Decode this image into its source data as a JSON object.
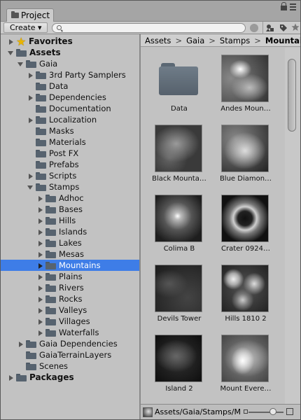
{
  "window": {
    "tab_title": "Project",
    "icons": [
      "folder-icon",
      "lock-icon",
      "menu-icon"
    ]
  },
  "toolbar": {
    "create_label": "Create ▾",
    "search_placeholder": "",
    "icons": [
      "search-icon",
      "search-clear-icon",
      "filter-by-type-icon",
      "filter-by-label-icon",
      "favorite-star-icon"
    ]
  },
  "tree": [
    {
      "label": "Favorites",
      "depth": 0,
      "arrow": "right",
      "icon": "star",
      "bold": true
    },
    {
      "label": "Assets",
      "depth": 0,
      "arrow": "down",
      "icon": "folder",
      "bold": true
    },
    {
      "label": "Gaia",
      "depth": 1,
      "arrow": "down",
      "icon": "folder"
    },
    {
      "label": "3rd Party Samplers",
      "depth": 2,
      "arrow": "right",
      "icon": "folder"
    },
    {
      "label": "Data",
      "depth": 2,
      "arrow": "",
      "icon": "folder"
    },
    {
      "label": "Dependencies",
      "depth": 2,
      "arrow": "right",
      "icon": "folder"
    },
    {
      "label": "Documentation",
      "depth": 2,
      "arrow": "",
      "icon": "folder"
    },
    {
      "label": "Localization",
      "depth": 2,
      "arrow": "right",
      "icon": "folder"
    },
    {
      "label": "Masks",
      "depth": 2,
      "arrow": "",
      "icon": "folder"
    },
    {
      "label": "Materials",
      "depth": 2,
      "arrow": "",
      "icon": "folder"
    },
    {
      "label": "Post FX",
      "depth": 2,
      "arrow": "",
      "icon": "folder"
    },
    {
      "label": "Prefabs",
      "depth": 2,
      "arrow": "",
      "icon": "folder"
    },
    {
      "label": "Scripts",
      "depth": 2,
      "arrow": "right",
      "icon": "folder"
    },
    {
      "label": "Stamps",
      "depth": 2,
      "arrow": "down",
      "icon": "folder"
    },
    {
      "label": "Adhoc",
      "depth": 3,
      "arrow": "right",
      "icon": "folder"
    },
    {
      "label": "Bases",
      "depth": 3,
      "arrow": "right",
      "icon": "folder"
    },
    {
      "label": "Hills",
      "depth": 3,
      "arrow": "right",
      "icon": "folder"
    },
    {
      "label": "Islands",
      "depth": 3,
      "arrow": "right",
      "icon": "folder"
    },
    {
      "label": "Lakes",
      "depth": 3,
      "arrow": "right",
      "icon": "folder"
    },
    {
      "label": "Mesas",
      "depth": 3,
      "arrow": "right",
      "icon": "folder"
    },
    {
      "label": "Mountains",
      "depth": 3,
      "arrow": "right",
      "icon": "folder",
      "selected": true
    },
    {
      "label": "Plains",
      "depth": 3,
      "arrow": "right",
      "icon": "folder"
    },
    {
      "label": "Rivers",
      "depth": 3,
      "arrow": "right",
      "icon": "folder"
    },
    {
      "label": "Rocks",
      "depth": 3,
      "arrow": "right",
      "icon": "folder"
    },
    {
      "label": "Valleys",
      "depth": 3,
      "arrow": "right",
      "icon": "folder"
    },
    {
      "label": "Villages",
      "depth": 3,
      "arrow": "right",
      "icon": "folder"
    },
    {
      "label": "Waterfalls",
      "depth": 3,
      "arrow": "right",
      "icon": "folder"
    },
    {
      "label": "Gaia Dependencies",
      "depth": 1,
      "arrow": "right",
      "icon": "folder"
    },
    {
      "label": "GaiaTerrainLayers",
      "depth": 1,
      "arrow": "",
      "icon": "folder"
    },
    {
      "label": "Scenes",
      "depth": 1,
      "arrow": "",
      "icon": "folder"
    },
    {
      "label": "Packages",
      "depth": 0,
      "arrow": "right",
      "icon": "folder",
      "bold": true
    }
  ],
  "breadcrumbs": [
    "Assets",
    "Gaia",
    "Stamps",
    "Mountains"
  ],
  "assets": [
    {
      "label": "Data",
      "kind": "folder"
    },
    {
      "label": "Andes Moun…",
      "kind": "heightmap",
      "style": "andes"
    },
    {
      "label": "Black Mounta…",
      "kind": "heightmap",
      "style": "black"
    },
    {
      "label": "Blue Diamon…",
      "kind": "heightmap",
      "style": "blue"
    },
    {
      "label": "Colima B",
      "kind": "heightmap",
      "style": "colima"
    },
    {
      "label": "Crater 0924…",
      "kind": "heightmap",
      "style": "crater"
    },
    {
      "label": "Devils Tower",
      "kind": "heightmap",
      "style": "devils"
    },
    {
      "label": "Hills 1810 2",
      "kind": "heightmap",
      "style": "hills"
    },
    {
      "label": "Island 2",
      "kind": "heightmap",
      "style": "island"
    },
    {
      "label": "Mount Evere…",
      "kind": "heightmap",
      "style": "everest"
    }
  ],
  "status": {
    "path": "Assets/Gaia/Stamps/M",
    "zoom": 0.7
  },
  "colors": {
    "selection": "#3e7de7",
    "panel": "#c2c2c2",
    "folder": "#57636f"
  }
}
